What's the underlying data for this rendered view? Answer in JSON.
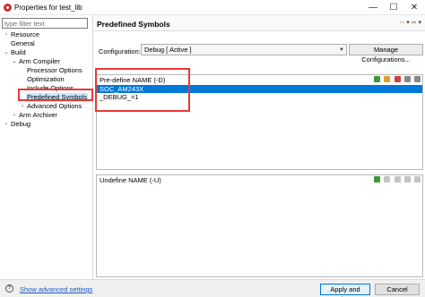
{
  "window": {
    "title": "Properties for test_lib",
    "minimize": "—",
    "maximize": "☐",
    "close": "✕"
  },
  "filter": {
    "placeholder": "type filter text"
  },
  "tree": {
    "resource": "Resource",
    "general": "General",
    "build": "Build",
    "arm_compiler": "Arm Compiler",
    "processor_options": "Processor Options",
    "optimization": "Optimization",
    "include_options": "Include Options",
    "predefined_symbols": "Predefined Symbols",
    "advanced_options": "Advanced Options",
    "arm_archiver": "Arm Archiver",
    "debug": "Debug"
  },
  "page": {
    "title": "Predefined Symbols",
    "nav_back": "⇦",
    "nav_fwd": "⇨",
    "nav_menu": "▾"
  },
  "configuration": {
    "label": "Configuration:",
    "value": "Debug  [ Active ]",
    "arrow": "▼",
    "manage_label": "Manage Configurations..."
  },
  "predefine": {
    "title": "Pre-define NAME (-D)",
    "rows": [
      "SOC_AM243X",
      "_DEBUG_=1"
    ]
  },
  "undefine": {
    "title": "Undefine NAME (-U)"
  },
  "footer": {
    "help": "?",
    "show_advanced": "Show advanced settings",
    "apply_close": "Apply and Close",
    "cancel": "Cancel"
  }
}
